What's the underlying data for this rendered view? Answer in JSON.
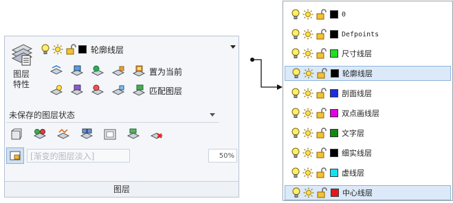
{
  "panel": {
    "big_button_label_line1": "图层",
    "big_button_label_line2": "特性",
    "current_layer": {
      "name": "轮廓线层",
      "color": "#000000"
    },
    "make_current_label": "置为当前",
    "match_layer_label": "匹配图层",
    "state_combo_value": "未保存的图层状态",
    "isolate_placeholder": "[渐变的图层淡入]",
    "isolate_percent": "50%",
    "title": "图层"
  },
  "layer_list": [
    {
      "name": "0",
      "color": "#000000",
      "mono": true
    },
    {
      "name": "Defpoints",
      "color": "#000000",
      "mono": true
    },
    {
      "name": "尺寸线层",
      "color": "#22dd22",
      "mono": false
    },
    {
      "name": "轮廓线层",
      "color": "#000000",
      "mono": false,
      "selected": true
    },
    {
      "name": "剖面线层",
      "color": "#1e2ddd",
      "mono": false
    },
    {
      "name": "双点画线层",
      "color": "#e000e0",
      "mono": false
    },
    {
      "name": "文字层",
      "color": "#118811",
      "mono": false
    },
    {
      "name": "细实线层",
      "color": "#000000",
      "mono": false
    },
    {
      "name": "虚线层",
      "color": "#11e2f0",
      "mono": false
    },
    {
      "name": "中心线层",
      "color": "#e41818",
      "mono": false,
      "selected": true
    }
  ],
  "icons": {
    "bulb": "lightbulb-icon",
    "sun": "sun-icon",
    "lock": "unlock-icon"
  },
  "colors": {
    "selection": "#dbe9f8",
    "selection_border": "#8fb4e0"
  }
}
